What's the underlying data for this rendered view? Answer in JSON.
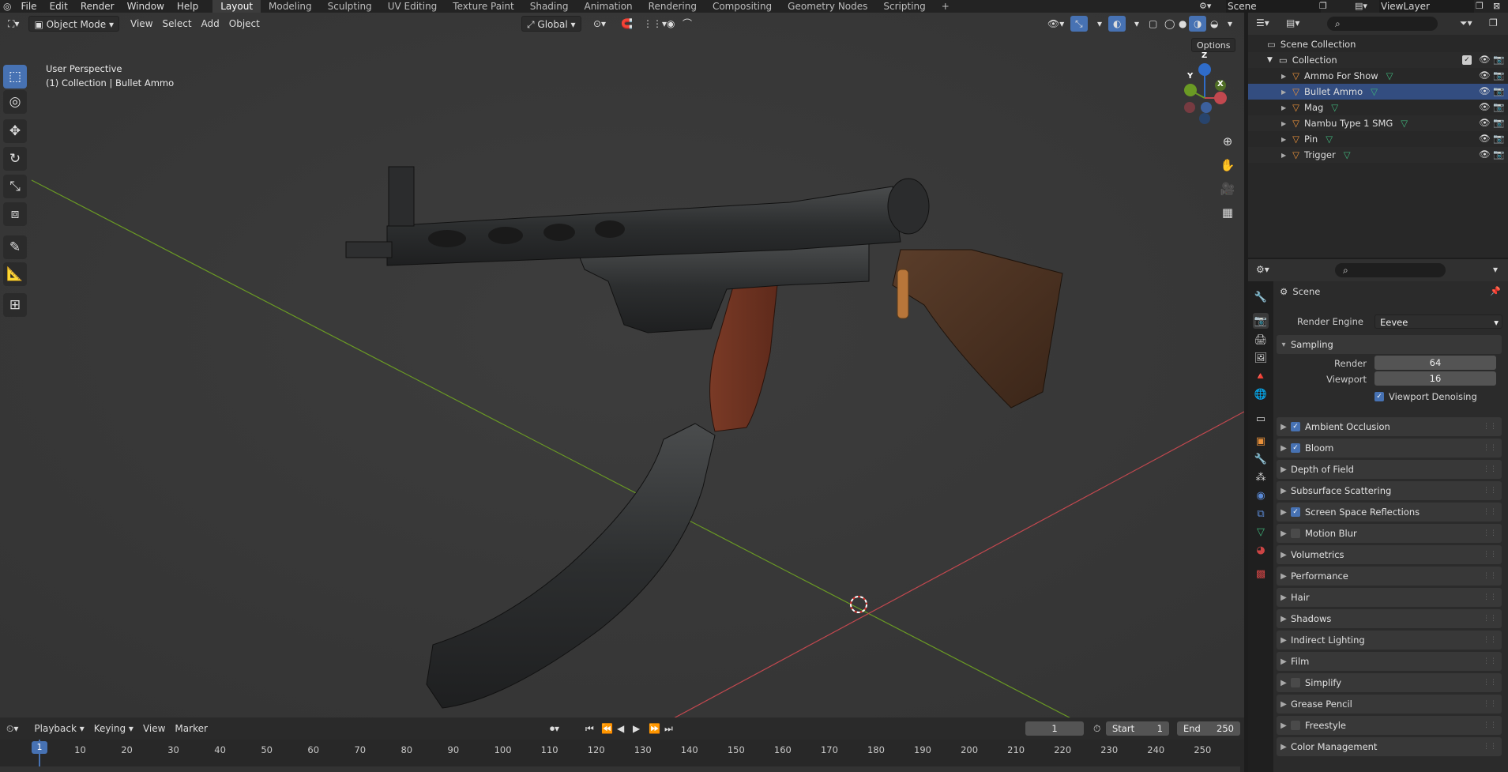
{
  "topbar": {
    "menus": [
      "File",
      "Edit",
      "Render",
      "Window",
      "Help"
    ],
    "workspaces": [
      "Layout",
      "Modeling",
      "Sculpting",
      "UV Editing",
      "Texture Paint",
      "Shading",
      "Animation",
      "Rendering",
      "Compositing",
      "Geometry Nodes",
      "Scripting"
    ],
    "active_workspace": "Layout",
    "add_tab": "+",
    "scene": "Scene",
    "view_layer": "ViewLayer"
  },
  "viewport_header": {
    "mode": "Object Mode",
    "menus": [
      "View",
      "Select",
      "Add",
      "Object"
    ],
    "orientation": "Global",
    "options": "Options"
  },
  "viewport": {
    "perspective": "User Perspective",
    "context": "(1) Collection | Bullet Ammo",
    "gizmo": {
      "x": "X",
      "y": "Y",
      "z": "Z"
    },
    "colors": {
      "x_axis": "#c2484f",
      "y_axis": "#6a9a24",
      "z_axis": "#2f6cc9"
    }
  },
  "outliner": {
    "root": "Scene Collection",
    "collection": "Collection",
    "items": [
      {
        "name": "Ammo For Show",
        "selected": false
      },
      {
        "name": "Bullet Ammo",
        "selected": true
      },
      {
        "name": "Mag",
        "selected": false
      },
      {
        "name": "Nambu Type 1 SMG",
        "selected": false
      },
      {
        "name": "Pin",
        "selected": false
      },
      {
        "name": "Trigger",
        "selected": false
      }
    ]
  },
  "properties": {
    "title": "Scene",
    "render_engine_label": "Render Engine",
    "render_engine": "Eevee",
    "sampling": {
      "label": "Sampling",
      "render_label": "Render",
      "render": "64",
      "viewport_label": "Viewport",
      "viewport": "16",
      "denoise_label": "Viewport Denoising"
    },
    "panels": [
      {
        "label": "Ambient Occlusion",
        "checkbox": true,
        "checked": true
      },
      {
        "label": "Bloom",
        "checkbox": true,
        "checked": true
      },
      {
        "label": "Depth of Field",
        "checkbox": false,
        "checked": false
      },
      {
        "label": "Subsurface Scattering",
        "checkbox": false,
        "checked": false
      },
      {
        "label": "Screen Space Reflections",
        "checkbox": true,
        "checked": true
      },
      {
        "label": "Motion Blur",
        "checkbox": true,
        "checked": false
      },
      {
        "label": "Volumetrics",
        "checkbox": false,
        "checked": false
      },
      {
        "label": "Performance",
        "checkbox": false,
        "checked": false
      },
      {
        "label": "Hair",
        "checkbox": false,
        "checked": false
      },
      {
        "label": "Shadows",
        "checkbox": false,
        "checked": false
      },
      {
        "label": "Indirect Lighting",
        "checkbox": false,
        "checked": false
      },
      {
        "label": "Film",
        "checkbox": false,
        "checked": false
      },
      {
        "label": "Simplify",
        "checkbox": true,
        "checked": false
      },
      {
        "label": "Grease Pencil",
        "checkbox": false,
        "checked": false
      },
      {
        "label": "Freestyle",
        "checkbox": true,
        "checked": false
      },
      {
        "label": "Color Management",
        "checkbox": false,
        "checked": false
      }
    ]
  },
  "timeline": {
    "menus": [
      "Playback",
      "Keying",
      "View",
      "Marker"
    ],
    "current_frame": "1",
    "start_label": "Start",
    "start": "1",
    "end_label": "End",
    "end": "250",
    "ticks": [
      "1",
      "10",
      "20",
      "30",
      "40",
      "50",
      "60",
      "70",
      "80",
      "90",
      "100",
      "110",
      "120",
      "130",
      "140",
      "150",
      "160",
      "170",
      "180",
      "190",
      "200",
      "210",
      "220",
      "230",
      "240",
      "250"
    ]
  }
}
